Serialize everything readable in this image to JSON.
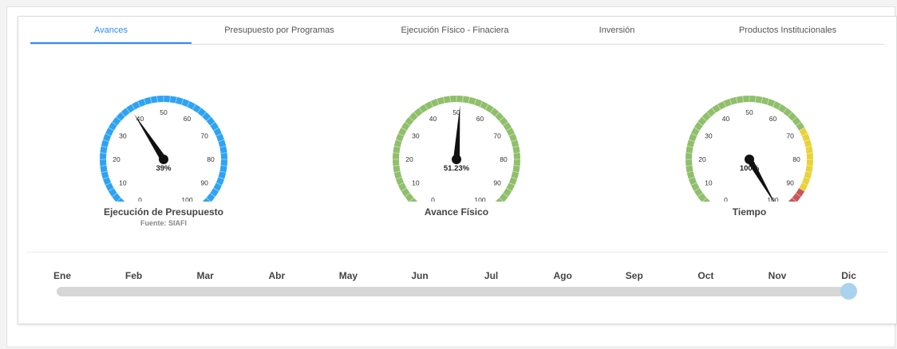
{
  "tabs": [
    {
      "label": "Avances",
      "active": true
    },
    {
      "label": "Presupuesto por Programas",
      "active": false
    },
    {
      "label": "Ejecución Físico - Finaciera",
      "active": false
    },
    {
      "label": "Inversión",
      "active": false
    },
    {
      "label": "Productos Institucionales",
      "active": false
    }
  ],
  "gauges": [
    {
      "title": "Ejecución de Presupuesto",
      "subtitle": "Fuente: SIAFI",
      "value": 39,
      "value_label": "39%",
      "min": 0,
      "max": 100,
      "ticks": [
        "0",
        "10",
        "20",
        "30",
        "40",
        "50",
        "60",
        "70",
        "80",
        "90",
        "100"
      ],
      "bands": [
        {
          "from": 0,
          "to": 100,
          "color": "#2ea3f2"
        }
      ]
    },
    {
      "title": "Avance Físico",
      "value": 51.23,
      "value_label": "51.23%",
      "min": 0,
      "max": 100,
      "ticks": [
        "0",
        "10",
        "20",
        "30",
        "40",
        "50",
        "60",
        "70",
        "80",
        "90",
        "100"
      ],
      "bands": [
        {
          "from": 0,
          "to": 100,
          "color": "#8fbf6a"
        }
      ]
    },
    {
      "title": "Tiempo",
      "value": 100,
      "value_label": "100%",
      "min": 0,
      "max": 100,
      "ticks": [
        "0",
        "10",
        "20",
        "30",
        "40",
        "50",
        "60",
        "70",
        "80",
        "90",
        "100"
      ],
      "bands": [
        {
          "from": 0,
          "to": 70,
          "color": "#8fbf6a"
        },
        {
          "from": 70,
          "to": 90,
          "color": "#e9d23a"
        },
        {
          "from": 90,
          "to": 100,
          "color": "#cc5555"
        }
      ]
    }
  ],
  "timeline": {
    "months": [
      "Ene",
      "Feb",
      "Mar",
      "Abr",
      "May",
      "Jun",
      "Jul",
      "Ago",
      "Sep",
      "Oct",
      "Nov",
      "Dic"
    ],
    "selected": "Dic"
  }
}
